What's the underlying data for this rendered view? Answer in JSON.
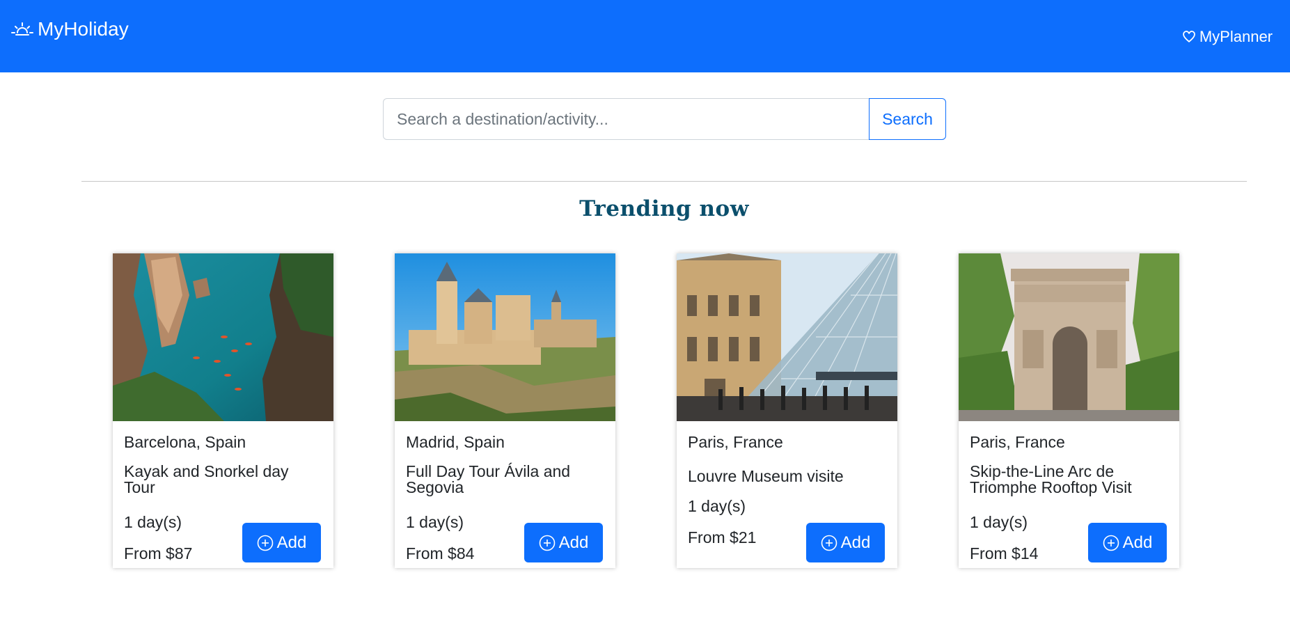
{
  "navbar": {
    "brand": "MyHoliday",
    "planner_link": "MyPlanner",
    "brand_icon": "sunrise-icon",
    "planner_icon": "heart-icon",
    "bg_color": "#0d6efd"
  },
  "search": {
    "placeholder": "Search a destination/activity...",
    "value": "",
    "button_label": "Search"
  },
  "section": {
    "title": "Trending now",
    "title_color": "#0b4f6c"
  },
  "cards": [
    {
      "location": "Barcelona, Spain",
      "title": "Kayak and Snorkel day Tour",
      "duration": "1 day(s)",
      "price": "From $87",
      "add_label": "Add",
      "image": "kayak-coast-photo"
    },
    {
      "location": "Madrid, Spain",
      "title": "Full Day Tour Ávila and Segovia",
      "duration": "1 day(s)",
      "price": "From $84",
      "add_label": "Add",
      "image": "segovia-castle-photo"
    },
    {
      "location": "Paris, France",
      "title": "Louvre Museum visite",
      "duration": "1 day(s)",
      "price": "From $21",
      "add_label": "Add",
      "image": "louvre-pyramid-photo"
    },
    {
      "location": "Paris, France",
      "title": "Skip-the-Line Arc de Triomphe Rooftop Visit",
      "duration": "1 day(s)",
      "price": "From $14",
      "add_label": "Add",
      "image": "arc-de-triomphe-photo"
    }
  ]
}
